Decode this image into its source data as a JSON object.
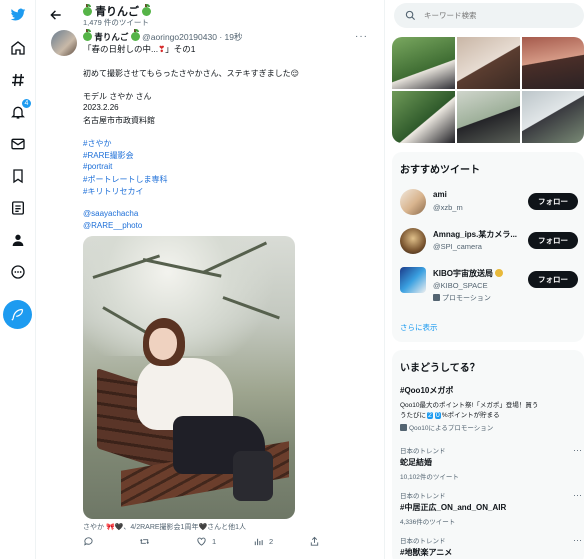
{
  "app": {
    "accent": "#1d9bf0",
    "name": "Twitter"
  },
  "nav": {
    "items": [
      {
        "name": "home",
        "icon": "home-icon"
      },
      {
        "name": "explore",
        "icon": "hashtag-icon"
      },
      {
        "name": "notifications",
        "icon": "bell-icon",
        "badge": "4"
      },
      {
        "name": "messages",
        "icon": "mail-icon"
      },
      {
        "name": "bookmarks",
        "icon": "bookmark-icon"
      },
      {
        "name": "lists",
        "icon": "list-icon"
      },
      {
        "name": "profile",
        "icon": "person-icon"
      },
      {
        "name": "more",
        "icon": "more-circle-icon"
      }
    ],
    "compose_icon": "feather-icon"
  },
  "header": {
    "name": "青りんご",
    "tweet_count": "1,479 件のツイート"
  },
  "tweet": {
    "display_name": "青りんご",
    "handle": "@aoringo20190430",
    "separator": "·",
    "time": "19秒",
    "more": "···",
    "reply_line": "「春の日射しの中...",
    "reply_suffix": "」その1",
    "line1": "初めて撮影させてもらったさやかさん、ステキすぎました😌",
    "line2": "モデル さやか さん",
    "line3": "2023.2.26",
    "line4": "名古屋市市政資料館",
    "tags": [
      "#さやか",
      "#RARE撮影会",
      "#portrait",
      "#ポートレートしま専科",
      "#キリトリセカイ"
    ],
    "mentions": [
      "@saayachacha",
      "@RARE__photo"
    ],
    "replied_by": "さやか 🎀🖤、4/2RARE撮影会1周年🖤さんと他1人",
    "actions": {
      "reply": "",
      "retweet": "",
      "like": "1",
      "views": "2",
      "share": ""
    }
  },
  "search": {
    "placeholder": "キーワード検索"
  },
  "recommended": {
    "title": "おすすめツイート",
    "accounts": [
      {
        "name": "ami",
        "handle": "@xzb_m",
        "button": "フォロー"
      },
      {
        "name": "Amnag_ips.某カメラ...",
        "handle": "@SPI_camera",
        "button": "フォロー"
      },
      {
        "name": "KIBO宇宙放送局",
        "handle": "@KIBO_SPACE",
        "promo": "プロモーション",
        "button": "フォロー"
      }
    ],
    "show_more": "さらに表示"
  },
  "trends": {
    "title": "いまどうしてる？",
    "items": [
      {
        "category": "",
        "title": "#Qoo10メガポ",
        "desc_a": "Qoo10最大のポイント祭!「メガポ」登場！買う",
        "desc_b": "うたびに",
        "desc_n1": "2",
        "desc_n2": "0",
        "desc_c": "%ポイントが貯まる",
        "promo": "Qoo10によるプロモーション"
      },
      {
        "category": "日本のトレンド",
        "title": "蛇足結婚",
        "count": "10,102件のツイート"
      },
      {
        "category": "日本のトレンド",
        "title": "#中居正広_ON_and_ON_AIR",
        "count": "4,336件のツイート"
      },
      {
        "category": "日本のトレンド",
        "title": "#地獣楽アニメ",
        "count": ""
      }
    ]
  }
}
